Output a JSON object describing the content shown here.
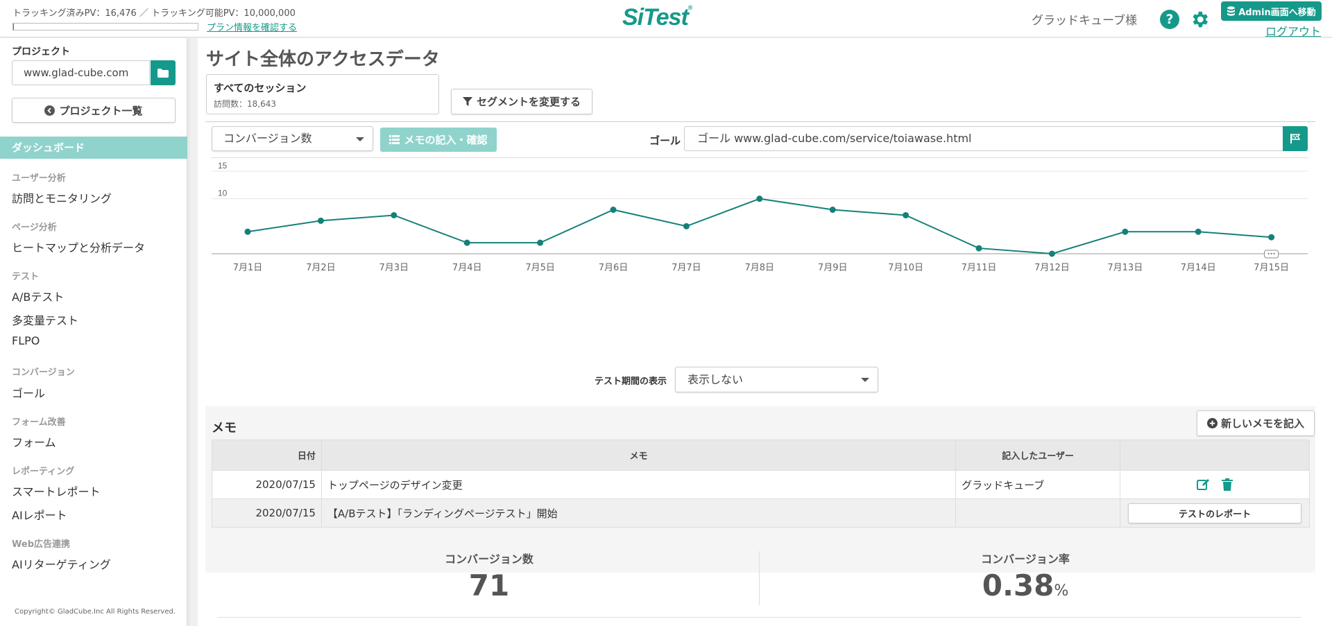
{
  "header": {
    "pv_status": "トラッキング済みPV：16,476 ／ トラッキング可能PV：10,000,000",
    "pv_usage_fraction": 0.0016476,
    "plan_link": "プラン情報を確認する",
    "logo": "SiTest",
    "user_name": "グラッドキューブ様",
    "admin_button": "Admin画面へ移動",
    "logout": "ログアウト"
  },
  "sidebar": {
    "project_label": "プロジェクト",
    "project_value": "www.glad-cube.com",
    "project_list_button": "プロジェクト一覧",
    "dashboard": "ダッシュボード",
    "sections": [
      {
        "title": "ユーザー分析",
        "items": [
          "訪問とモニタリング"
        ]
      },
      {
        "title": "ページ分析",
        "items": [
          "ヒートマップと分析データ"
        ]
      },
      {
        "title": "テスト",
        "items": [
          "A/Bテスト",
          "多変量テスト",
          "FLPO"
        ]
      },
      {
        "title": "コンバージョン",
        "items": [
          "ゴール"
        ]
      },
      {
        "title": "フォーム改善",
        "items": [
          "フォーム"
        ]
      },
      {
        "title": "レポーティング",
        "items": [
          "スマートレポート",
          "AIレポート"
        ]
      },
      {
        "title": "Web広告連携",
        "items": [
          "AIリターゲティング"
        ]
      }
    ],
    "copyright": "Copyright© GladCube.Inc All Rights Reserved."
  },
  "main": {
    "title": "サイト全体のアクセスデータ",
    "segment": {
      "title": "すべてのセッション",
      "visits": "訪問数：18,643",
      "change_button": "セグメントを変更する"
    },
    "metric_select": "コンバージョン数",
    "memo_button": "メモの記入・確認",
    "goal_label": "ゴール",
    "goal_value": "ゴール www.glad-cube.com/service/toiawase.html",
    "period_label": "テスト期間の表示",
    "period_select": "表示しない"
  },
  "chart_data": {
    "type": "line",
    "categories": [
      "7月1日",
      "7月2日",
      "7月3日",
      "7月4日",
      "7月5日",
      "7月6日",
      "7月7日",
      "7月8日",
      "7月9日",
      "7月10日",
      "7月11日",
      "7月12日",
      "7月13日",
      "7月14日",
      "7月15日"
    ],
    "values": [
      4,
      6,
      7,
      2,
      2,
      8,
      5,
      10,
      8,
      7,
      1,
      0,
      4,
      4,
      3
    ],
    "yticks": [
      10,
      15
    ],
    "ylim": [
      0,
      15
    ],
    "color": "#15807a",
    "memo_marker_category": "7月15日"
  },
  "memo": {
    "heading": "メモ",
    "new_button": "新しいメモを記入",
    "columns": [
      "日付",
      "メモ",
      "記入したユーザー",
      ""
    ],
    "rows": [
      {
        "date": "2020/07/15",
        "memo": "トップページのデザイン変更",
        "user": "グラッドキューブ"
      },
      {
        "date": "2020/07/15",
        "memo": "【A/Bテスト】「ランディングページテスト」開始",
        "user": "",
        "action": "テストのレポート"
      }
    ]
  },
  "stats": {
    "conversions_label": "コンバージョン数",
    "conversions_value": "71",
    "rate_label": "コンバージョン率",
    "rate_value": "0.38",
    "rate_unit": "%"
  },
  "colors": {
    "brand": "#15998a",
    "light_brand": "#8fd3cc"
  }
}
